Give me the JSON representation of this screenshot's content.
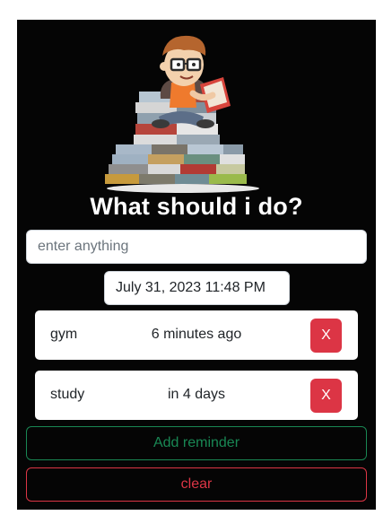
{
  "header": {
    "illustration_icon": "boy-reading-on-books-illustration",
    "title": "What should i do?"
  },
  "form": {
    "task_placeholder": "enter anything",
    "task_value": "",
    "datetime_value": "July 31, 2023 11:48 PM"
  },
  "reminders": [
    {
      "title": "gym",
      "time": "6 minutes ago",
      "delete_label": "X"
    },
    {
      "title": "study",
      "time": "in 4 days",
      "delete_label": "X"
    }
  ],
  "actions": {
    "add_label": "Add reminder",
    "clear_label": "clear"
  },
  "colors": {
    "background": "#050505",
    "danger": "#dc3545",
    "success": "#198754"
  }
}
